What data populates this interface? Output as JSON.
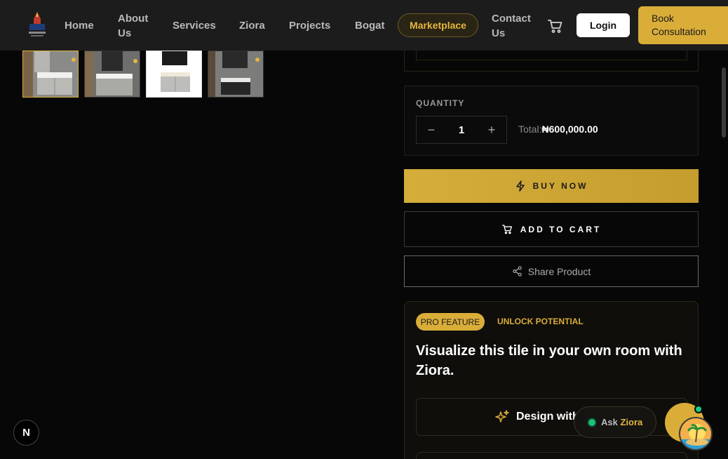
{
  "header": {
    "nav": [
      {
        "label": "Home"
      },
      {
        "label": "About Us"
      },
      {
        "label": "Services"
      },
      {
        "label": "Ziora"
      },
      {
        "label": "Projects"
      },
      {
        "label": "Bogat"
      },
      {
        "label": "Contact Us"
      }
    ],
    "marketplace_label": "Marketplace",
    "login_label": "Login",
    "book_label": "Book Consultation",
    "cart_icon": "cart-icon"
  },
  "gallery": {
    "thumbnails": [
      {
        "name": "vanity-thumb-1",
        "active": true
      },
      {
        "name": "vanity-thumb-2",
        "active": false
      },
      {
        "name": "vanity-thumb-3",
        "active": false
      },
      {
        "name": "vanity-thumb-4",
        "active": false
      }
    ]
  },
  "purchase": {
    "quantity_label": "QUANTITY",
    "decrement": "−",
    "increment": "+",
    "quantity": "1",
    "total_label": "Total:",
    "total_value": "₦600,000.00",
    "buy_now": "BUY NOW",
    "add_to_cart": "ADD TO CART",
    "share": "Share Product"
  },
  "pro": {
    "badge": "PRO FEATURE",
    "unlock": "UNLOCK POTENTIAL",
    "title": "Visualize this tile in your own room with Ziora.",
    "design_label": "Design with"
  },
  "widgets": {
    "ask_prefix": "Ask",
    "ask_name": "Ziora",
    "n_badge": "N"
  },
  "colors": {
    "accent": "#d9ad38",
    "background": "#070707",
    "header": "#1c1c1c",
    "online": "#1fbf74"
  }
}
